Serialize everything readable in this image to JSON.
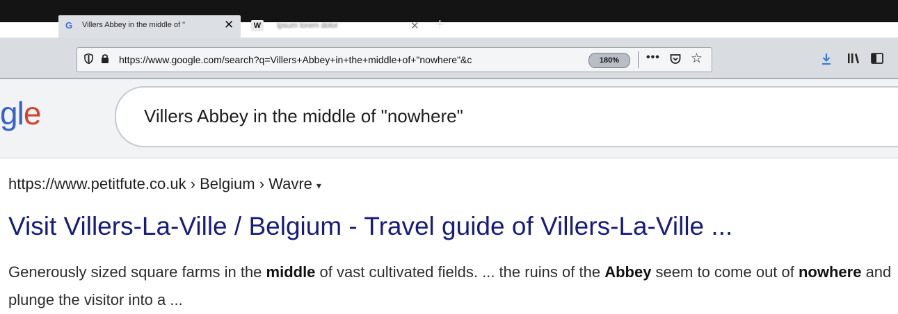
{
  "browser": {
    "tabs": [
      {
        "title": "Villers Abbey in the middle of \"",
        "favicon": "G",
        "active": true
      },
      {
        "title": "Ipsum lorem dolor",
        "favicon": "W",
        "active": false
      }
    ],
    "new_tab_label": "+",
    "url": "https://www.google.com/search?q=Villers+Abbey+in+the+middle+of+\"nowhere\"&c",
    "zoom": "180%",
    "more_label": "•••",
    "icons": [
      "shield-icon",
      "lock-icon",
      "pocket-icon",
      "star-icon",
      "download-icon",
      "library-icon",
      "sidebar-icon"
    ],
    "colors": {
      "accent_download": "#3a7bd5",
      "tabbar": "#141414",
      "toolbar": "#d9dce1"
    }
  },
  "search": {
    "logo_fragment_g": "gl",
    "logo_fragment_e": "e",
    "query": "Villers Abbey in the middle of \"nowhere\""
  },
  "result": {
    "breadcrumb": "https://www.petitfute.co.uk › Belgium › Wavre",
    "caret": "▾",
    "title": "Visit Villers-La-Ville / Belgium - Travel guide of Villers-La-Ville ...",
    "snippet": {
      "p1": "Generously sized square farms in the ",
      "b1": "middle",
      "p2": " of vast cultivated fields. ... the ruins of the ",
      "b2": "Abbey",
      "p3": " seem to come out of ",
      "b3": "nowhere",
      "p4": " and plunge the visitor into a ..."
    },
    "colors": {
      "title": "#161b7e",
      "text": "#2c2c2c"
    }
  }
}
